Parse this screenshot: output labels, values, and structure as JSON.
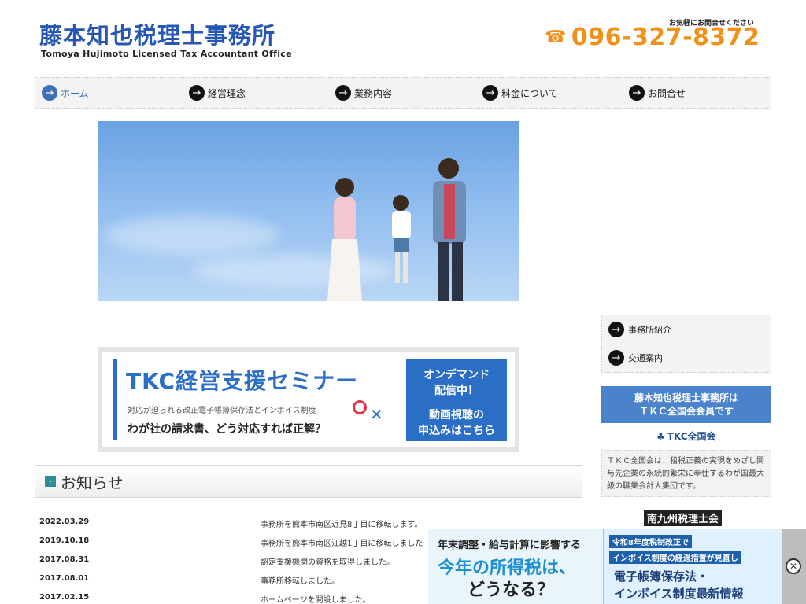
{
  "header": {
    "title": "藤本知也税理士事務所",
    "subtitle": "Tomoya Hujimoto Licensed Tax Accountant Office",
    "contact_note": "お気軽にお問合せください",
    "phone": "096-327-8372",
    "phone_icon": "phone-icon",
    "phone_color": "#f0911a",
    "brand_color": "#2557b3"
  },
  "nav": {
    "items": [
      {
        "label": "ホーム",
        "active": true
      },
      {
        "label": "経営理念"
      },
      {
        "label": "業務内容"
      },
      {
        "label": "料金について"
      },
      {
        "label": "お問合せ"
      }
    ]
  },
  "banner": {
    "title": "TKC経営支援セミナー",
    "subtitle": "対応が迫られる改正電子帳簿保存法とインボイス制度",
    "question": "わが社の請求書、どう対応すれば正解？",
    "cta_line1": "オンデマンド",
    "cta_line2": "配信中！",
    "cta_line3": "動画視聴の",
    "cta_line4": "申込みはこちら"
  },
  "news": {
    "heading": "お知らせ",
    "items": [
      {
        "date": "2022.03.29",
        "text": "事務所を熊本市南区近見8丁目に移転します。"
      },
      {
        "date": "2019.10.18",
        "text": "事務所を熊本市南区江越1丁目に移転しました"
      },
      {
        "date": "2017.08.31",
        "text": "認定支援機関の資格を取得しました。"
      },
      {
        "date": "2017.08.01",
        "text": "事務所移転しました。"
      },
      {
        "date": "2017.02.15",
        "text": "ホームページを開設しました。"
      }
    ]
  },
  "sidebar": {
    "menu": [
      {
        "label": "事務所紹介"
      },
      {
        "label": "交通案内"
      }
    ],
    "member_line1": "藤本知也税理士事務所は",
    "member_line2": "ＴＫＣ全国会会員です",
    "tkc_logo": "TKC全国会",
    "tkc_description": "ＴＫＣ全国会は、租税正義の実現をめざし関与先企業の永続的繁栄に奉仕するわが国最大級の職業会計人集団です。",
    "minami_label": "南九州税理士会"
  },
  "ad": {
    "left_top": "年末調整・給与計算に影響する",
    "left_mid": "今年の所得税は、",
    "left_bot": "どうなる？",
    "right_1": "令和8年度税制改正で",
    "right_2": "インボイス制度の経過措置が見直し",
    "right_3": "電子帳簿保存法・",
    "right_4": "インボイス制度最新情報",
    "close_icon": "close-circle-icon"
  }
}
